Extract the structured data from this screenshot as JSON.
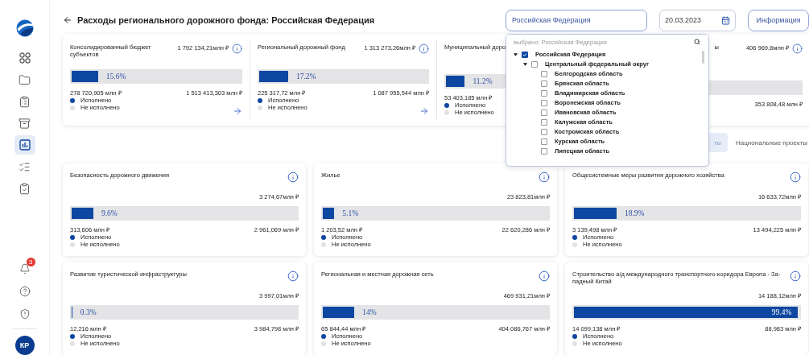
{
  "sidebar": {
    "nav": [
      {
        "kind": "grid",
        "selected": false
      },
      {
        "kind": "folder",
        "selected": false
      },
      {
        "kind": "clipboard",
        "selected": false
      },
      {
        "kind": "archive",
        "selected": false
      },
      {
        "kind": "chart",
        "selected": true
      },
      {
        "kind": "checklist",
        "selected": false
      },
      {
        "kind": "clipboard-check",
        "selected": false
      }
    ],
    "notifications_badge": "3",
    "avatar": "КР"
  },
  "header": {
    "title": "Расходы регионального дорожного фонда: Российская Федерация",
    "region_select": {
      "value": "Российская Федерация"
    },
    "date_field": {
      "value": "20.03.2023"
    },
    "info_button": "Информация"
  },
  "region_dropdown": {
    "search_placeholder": "выбрано: Российская Федерация",
    "tree": [
      {
        "label": "Российская Федерация",
        "checked": true,
        "expanded": true,
        "children": [
          {
            "label": "Центральный федеральный округ",
            "checked": false,
            "expanded": true,
            "children": [
              {
                "label": "Белгородская область",
                "checked": false
              },
              {
                "label": "Брянская область",
                "checked": false
              },
              {
                "label": "Владимирская область",
                "checked": false
              },
              {
                "label": "Воронежская область",
                "checked": false
              },
              {
                "label": "Ивановская область",
                "checked": false
              },
              {
                "label": "Калужская область",
                "checked": false
              },
              {
                "label": "Костромская область",
                "checked": false
              },
              {
                "label": "Курская область",
                "checked": false
              },
              {
                "label": "Липецкая область",
                "checked": false
              }
            ]
          }
        ]
      }
    ]
  },
  "summary": [
    {
      "kind": "full",
      "title": "Консолидированный бюджет субъектов",
      "total": "1 792 134,21млн ₽",
      "level": 0.156,
      "percent": "15.6%",
      "done": "278 720,905 млн ₽",
      "remaining": "1 513 413,303 млн ₽",
      "legend": [
        "Исполнено",
        "Не исполнено"
      ],
      "link_arrow": true
    },
    {
      "kind": "full",
      "title": "Региональный дорожный фонд",
      "total": "1 313 273,26млн ₽",
      "level": 0.172,
      "percent": "17.2%",
      "done": "225 317,72 млн ₽",
      "remaining": "1 087 955,544 млн ₽",
      "legend": [
        "Исполнено",
        "Не исполнено"
      ],
      "link_arrow": true
    },
    {
      "kind": "full",
      "title": "Муниципальный доро",
      "level": 0.112,
      "percent": "11.2%",
      "done": "53 403,185 млн ₽",
      "legend": [
        "Исполнено",
        "Не исполнено"
      ]
    },
    {
      "kind": "tail",
      "title": "ы",
      "total": "406 969,8млн ₽",
      "remaining": "353 808,48 млн ₽"
    }
  ],
  "tabs": [
    {
      "label": "ты",
      "selected": true
    },
    {
      "label": "Национальные проекты",
      "selected": false
    }
  ],
  "cards": [
    {
      "title": "Безопасность дорожного движения",
      "total": "3 274,67млн ₽",
      "level": 0.096,
      "percent": "9.6%",
      "done": "313,606 млн ₽",
      "remaining": "2 961,069 млн ₽",
      "legend": [
        "Исполнено",
        "Не исполнено"
      ]
    },
    {
      "title": "Жилье",
      "total": "23 823,81млн ₽",
      "level": 0.051,
      "percent": "5.1%",
      "done": "1 203,52 млн ₽",
      "remaining": "22 620,286 млн ₽",
      "legend": [
        "Исполнено",
        "Не исполнено"
      ]
    },
    {
      "title": "Общесистемные меры развития дорожного хозяйства",
      "total": "16 633,72млн ₽",
      "level": 0.189,
      "percent": "18.9%",
      "done": "3 139,498 млн ₽",
      "remaining": "13 494,225 млн ₽",
      "legend": [
        "Исполнено",
        "Не исполнено"
      ]
    },
    {
      "title": "Развитие туристической инфраструктуры",
      "total": "3 997,01млн ₽",
      "level": 0.003,
      "percent": "0.3%",
      "done": "12,216 млн ₽",
      "remaining": "3 984,798 млн ₽",
      "legend": [
        "Исполнено",
        "Не исполнено"
      ]
    },
    {
      "title": "Региональная и местная дорожная сеть",
      "total": "469 931,21млн ₽",
      "level": 0.14,
      "percent": "14%",
      "done": "65 844,44 млн ₽",
      "remaining": "404 086,767 млн ₽",
      "legend": [
        "Исполнено",
        "Не исполнено"
      ]
    },
    {
      "title": "Строительство а/д международного транспортного коридора Европа - За-падный Китай",
      "total": "14 188,12млн ₽",
      "level": 0.994,
      "percent": "99.4%",
      "done": "14 099,138 млн ₽",
      "remaining": "88,983 млн ₽",
      "legend": [
        "Исполнено",
        "Не исполнено"
      ]
    }
  ]
}
